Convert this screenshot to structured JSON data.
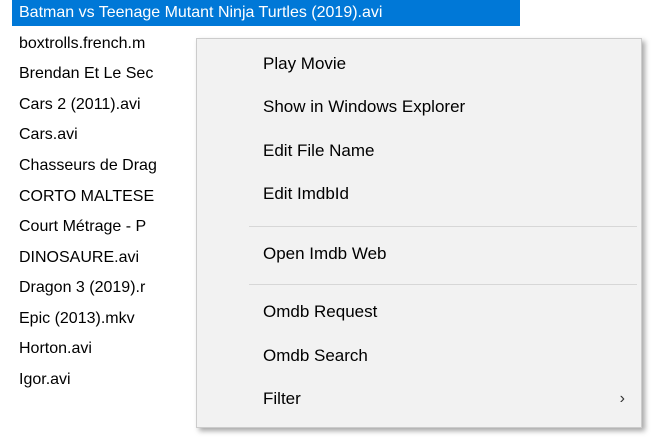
{
  "file_list": {
    "items": [
      "Batman vs Teenage Mutant Ninja Turtles (2019).avi",
      "boxtrolls.french.m",
      "Brendan Et Le Sec",
      "Cars 2 (2011).avi",
      "Cars.avi",
      "Chasseurs de Drag",
      "CORTO MALTESE",
      "Court Métrage - P",
      "DINOSAURE.avi",
      "Dragon 3 (2019).r",
      "Epic (2013).mkv",
      "Horton.avi",
      "Igor.avi"
    ],
    "selected_index": 0
  },
  "context_menu": {
    "items": [
      {
        "label": "Play Movie"
      },
      {
        "label": "Show in Windows Explorer"
      },
      {
        "label": "Edit File Name"
      },
      {
        "label": "Edit ImdbId"
      },
      {
        "label": "Open Imdb Web"
      },
      {
        "label": "Omdb Request"
      },
      {
        "label": "Omdb Search"
      },
      {
        "label": "Filter",
        "submenu_icon": "chevron-right-icon",
        "submenu_glyph": "›"
      }
    ]
  },
  "colors": {
    "selection": "#0078d7",
    "menu_background": "#f2f2f2"
  }
}
